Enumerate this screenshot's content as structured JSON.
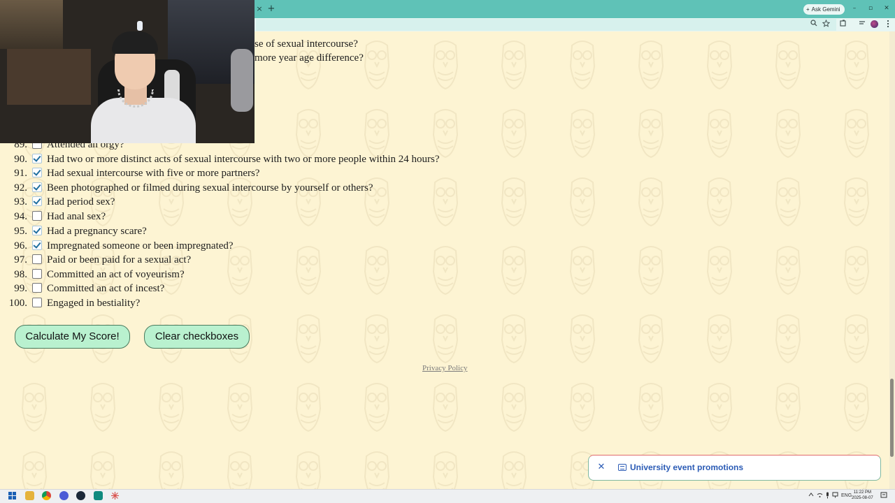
{
  "browser": {
    "tab_close": "×",
    "tab_new": "+",
    "gemini_label": "Ask Gemini",
    "gemini_plus": "+",
    "min": "–",
    "restore": "▫",
    "close": "✕"
  },
  "page": {
    "partial_lines": [
      "se of sexual intercourse?",
      "more year age difference?"
    ],
    "questions": [
      {
        "num": "89.",
        "text": "Attended an orgy?",
        "checked": false
      },
      {
        "num": "90.",
        "text": "Had two or more distinct acts of sexual intercourse with two or more people within 24 hours?",
        "checked": true
      },
      {
        "num": "91.",
        "text": "Had sexual intercourse with five or more partners?",
        "checked": true
      },
      {
        "num": "92.",
        "text": "Been photographed or filmed during sexual intercourse by yourself or others?",
        "checked": true
      },
      {
        "num": "93.",
        "text": "Had period sex?",
        "checked": true
      },
      {
        "num": "94.",
        "text": "Had anal sex?",
        "checked": false
      },
      {
        "num": "95.",
        "text": "Had a pregnancy scare?",
        "checked": true
      },
      {
        "num": "96.",
        "text": "Impregnated someone or been impregnated?",
        "checked": true
      },
      {
        "num": "97.",
        "text": "Paid or been paid for a sexual act?",
        "checked": false
      },
      {
        "num": "98.",
        "text": "Committed an act of voyeurism?",
        "checked": false
      },
      {
        "num": "99.",
        "text": "Committed an act of incest?",
        "checked": false
      },
      {
        "num": "100.",
        "text": "Engaged in bestiality?",
        "checked": false
      }
    ],
    "calculate_label": "Calculate My Score!",
    "clear_label": "Clear checkboxes",
    "privacy_label": "Privacy Policy"
  },
  "notification": {
    "close": "✕",
    "text": "University event promotions"
  },
  "taskbar": {
    "lang": "ENG",
    "time": "11:22 PM",
    "date": "2025-08-07"
  }
}
